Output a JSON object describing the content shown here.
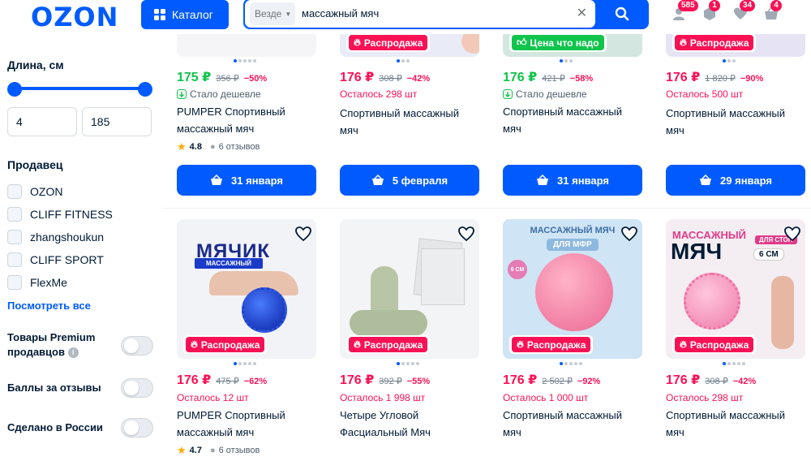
{
  "header": {
    "logo": "OZON",
    "catalog_label": "Каталог",
    "search_scope": "Везде",
    "search_query": "массажный мяч",
    "badges": {
      "profile": "585",
      "orders": "1",
      "favorites": "34",
      "cart": "4"
    }
  },
  "sidebar": {
    "length_title": "Длина, см",
    "length_min": "4",
    "length_max": "185",
    "seller_title": "Продавец",
    "sellers": [
      "OZON",
      "CLIFF FITNESS",
      "zhangshoukun",
      "CLIFF SPORT",
      "FlexMe"
    ],
    "see_all": "Посмотреть все",
    "premium_label_1": "Товары Premium",
    "premium_label_2": "продавцов",
    "reviews_label": "Баллы за отзывы",
    "russia_label": "Сделано в России"
  },
  "products_top": [
    {
      "price": "175 ₽",
      "old": "356 ₽",
      "disc": "−50%",
      "sub": "Стало дешевле",
      "name1": "PUMPER Спортивный",
      "name2": "массажный мяч",
      "rating": "4.8",
      "reviews": "6 отзывов",
      "date": "31 января"
    },
    {
      "tag": "Распродажа",
      "price": "176 ₽",
      "old": "308 ₽",
      "disc": "−42%",
      "sub": "Осталось 298 шт",
      "name1": "Спортивный массажный",
      "name2": "мяч",
      "date": "5 февраля"
    },
    {
      "tag": "Цена что надо",
      "price": "176 ₽",
      "old": "421 ₽",
      "disc": "−58%",
      "sub": "Стало дешевле",
      "name1": "Спортивный массажный",
      "name2": "мяч",
      "date": "31 января"
    },
    {
      "tag": "Распродажа",
      "price": "176 ₽",
      "old": "1 820 ₽",
      "disc": "−90%",
      "sub": "Осталось 500 шт",
      "name1": "Спортивный массажный",
      "name2": "мяч",
      "date": "29 января"
    }
  ],
  "products_bottom": [
    {
      "tag": "Распродажа",
      "price": "176 ₽",
      "old": "475 ₽",
      "disc": "−62%",
      "sub": "Осталось 12 шт",
      "name1": "PUMPER Спортивный",
      "name2": "массажный мяч",
      "rating": "4.7",
      "reviews": "6 отзывов",
      "img_title": "МЯЧИК",
      "img_sub": "МАССАЖНЫЙ"
    },
    {
      "tag": "Распродажа",
      "price": "176 ₽",
      "old": "392 ₽",
      "disc": "−55%",
      "sub": "Осталось 1 998 шт",
      "name1": "Четыре Угловой",
      "name2": "Фасциальный Мяч"
    },
    {
      "tag": "Распродажа",
      "price": "176 ₽",
      "old": "2 502 ₽",
      "disc": "−92%",
      "sub": "Осталось 1 000 шт",
      "name1": "Спортивный массажный",
      "name2": "мяч",
      "img_title": "МАССАЖНЫЙ МЯЧ",
      "img_sub": "ДЛЯ МФР",
      "img_size": "6 СМ"
    },
    {
      "tag": "Распродажа",
      "price": "176 ₽",
      "old": "308 ₽",
      "disc": "−42%",
      "sub": "Осталось 298 шт",
      "name1": "Спортивный массажный",
      "name2": "мяч",
      "img_title": "МАССАЖНЫЙ",
      "img_title2": "МЯЧ",
      "img_sub": "ДЛЯ СТОП",
      "img_size": "6 СМ"
    }
  ],
  "colors": {
    "brand": "#005bff",
    "sale": "#f91155",
    "green": "#10c44c"
  }
}
